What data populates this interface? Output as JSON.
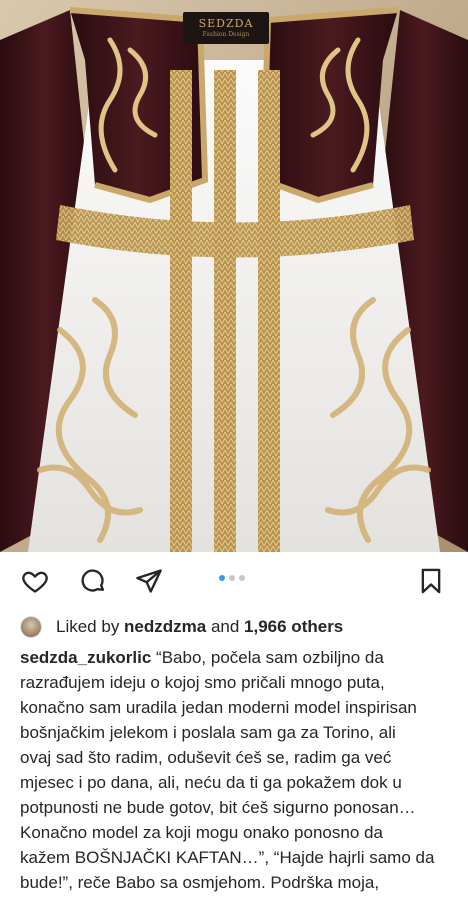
{
  "post": {
    "brand_label": "SEDZDA",
    "brand_sub": "Fashion Design"
  },
  "actions": {
    "like_icon": "heart-icon",
    "comment_icon": "comment-icon",
    "share_icon": "send-icon",
    "save_icon": "bookmark-icon"
  },
  "carousel": {
    "count": 3,
    "active_index": 0
  },
  "likes": {
    "prefix": "Liked by ",
    "user": "nedzdzma",
    "middle": " and ",
    "others": "1,966 others"
  },
  "caption": {
    "username": "sedzda_zukorlic",
    "lines": [
      " “Babo, počela sam ozbiljno da",
      "razrađujem ideju o kojoj smo pričali mnogo puta,",
      "konačno sam uradila jedan moderni model inspirisan",
      "bošnjačkim jelekom i poslala sam ga za Torino, ali",
      "ovaj sad što radim, oduševit ćeš se, radim ga već",
      "mjesec i po dana, ali, neću da ti ga pokažem dok u",
      "potpunosti ne bude gotov, bit ćeš sigurno ponosan…",
      "Konačno model za koji mogu onako ponosno da",
      "kažem BOŠNJAČKI KAFTAN…”, “Hajde hajrli samo da",
      "bude!”, reče Babo sa osmjehom. Podrška moja,"
    ]
  },
  "colors": {
    "accent_blue": "#3897f0",
    "text": "#262626",
    "gold": "#c9a86a",
    "velvet": "#3b1417"
  }
}
